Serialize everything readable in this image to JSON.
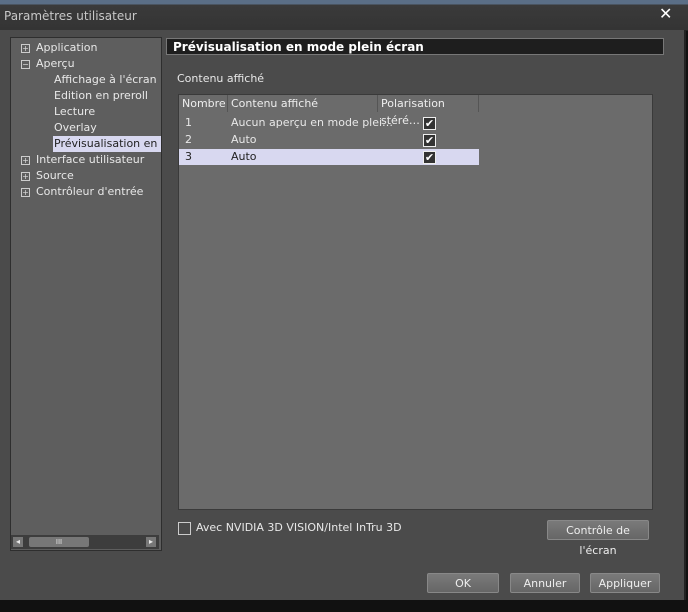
{
  "window": {
    "title": "Paramètres utilisateur",
    "close_icon": "close-icon"
  },
  "tree": {
    "items": [
      {
        "label": "Application",
        "expander": "+"
      },
      {
        "label": "Aperçu",
        "expander": "−"
      },
      {
        "label": "Affichage à l'écran"
      },
      {
        "label": "Edition en preroll"
      },
      {
        "label": "Lecture"
      },
      {
        "label": "Overlay"
      },
      {
        "label": "Prévisualisation en mo",
        "selected": true
      },
      {
        "label": "Interface utilisateur",
        "expander": "+"
      },
      {
        "label": "Source",
        "expander": "+"
      },
      {
        "label": "Contrôleur d'entrée",
        "expander": "+"
      }
    ],
    "scroll_left": "◂",
    "scroll_right": "▸",
    "scroll_grip": "III"
  },
  "panel": {
    "header": "Prévisualisation en mode plein écran",
    "section_label": "Contenu affiché",
    "table": {
      "columns": [
        "Nombre",
        "Contenu affiché",
        "Polarisation stéré…"
      ],
      "rows": [
        {
          "num": "1",
          "content": "Aucun aperçu en mode plei…",
          "checked": true
        },
        {
          "num": "2",
          "content": "Auto",
          "checked": true
        },
        {
          "num": "3",
          "content": "Auto",
          "checked": true,
          "selected": true
        }
      ]
    },
    "nvidia_checkbox": {
      "label": "Avec NVIDIA 3D VISION/Intel InTru 3D",
      "checked": false
    },
    "screen_control_button": "Contrôle de l'écran"
  },
  "footer": {
    "ok": "OK",
    "cancel": "Annuler",
    "apply": "Appliquer"
  },
  "check_glyph": "✔"
}
